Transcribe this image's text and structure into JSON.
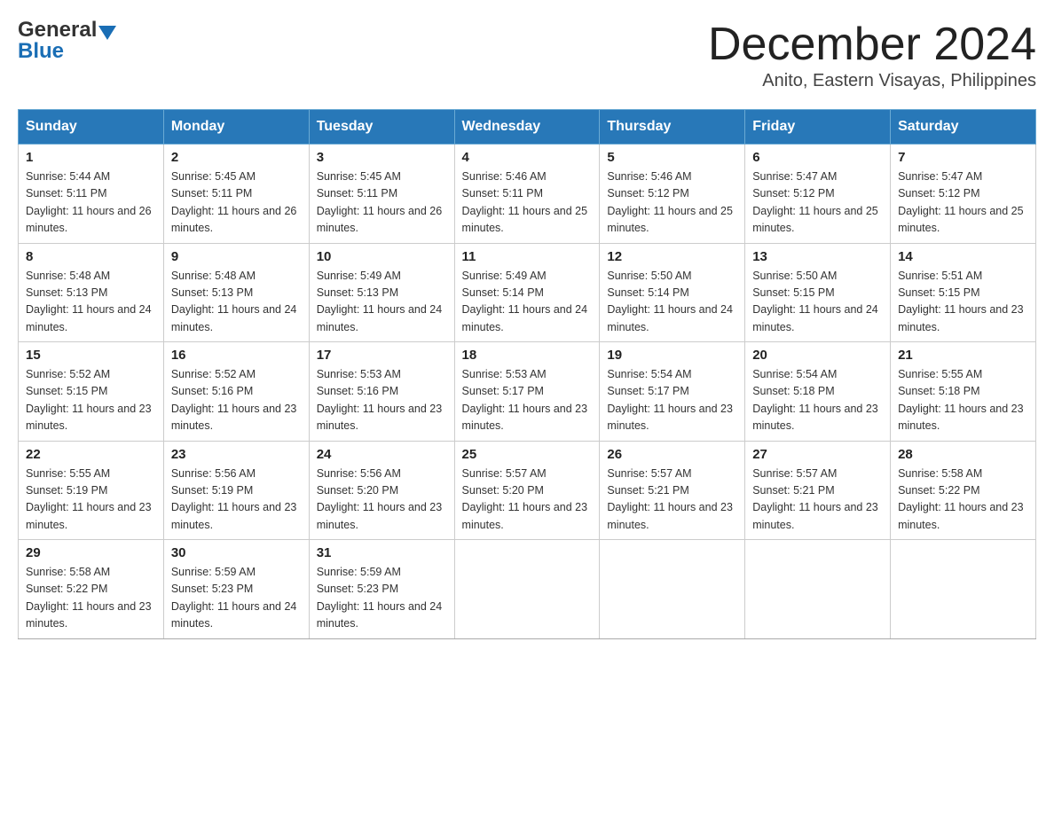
{
  "header": {
    "logo_general": "General",
    "logo_blue": "Blue",
    "title": "December 2024",
    "subtitle": "Anito, Eastern Visayas, Philippines"
  },
  "days_of_week": [
    "Sunday",
    "Monday",
    "Tuesday",
    "Wednesday",
    "Thursday",
    "Friday",
    "Saturday"
  ],
  "weeks": [
    [
      {
        "day": "1",
        "sunrise": "5:44 AM",
        "sunset": "5:11 PM",
        "daylight": "11 hours and 26 minutes."
      },
      {
        "day": "2",
        "sunrise": "5:45 AM",
        "sunset": "5:11 PM",
        "daylight": "11 hours and 26 minutes."
      },
      {
        "day": "3",
        "sunrise": "5:45 AM",
        "sunset": "5:11 PM",
        "daylight": "11 hours and 26 minutes."
      },
      {
        "day": "4",
        "sunrise": "5:46 AM",
        "sunset": "5:11 PM",
        "daylight": "11 hours and 25 minutes."
      },
      {
        "day": "5",
        "sunrise": "5:46 AM",
        "sunset": "5:12 PM",
        "daylight": "11 hours and 25 minutes."
      },
      {
        "day": "6",
        "sunrise": "5:47 AM",
        "sunset": "5:12 PM",
        "daylight": "11 hours and 25 minutes."
      },
      {
        "day": "7",
        "sunrise": "5:47 AM",
        "sunset": "5:12 PM",
        "daylight": "11 hours and 25 minutes."
      }
    ],
    [
      {
        "day": "8",
        "sunrise": "5:48 AM",
        "sunset": "5:13 PM",
        "daylight": "11 hours and 24 minutes."
      },
      {
        "day": "9",
        "sunrise": "5:48 AM",
        "sunset": "5:13 PM",
        "daylight": "11 hours and 24 minutes."
      },
      {
        "day": "10",
        "sunrise": "5:49 AM",
        "sunset": "5:13 PM",
        "daylight": "11 hours and 24 minutes."
      },
      {
        "day": "11",
        "sunrise": "5:49 AM",
        "sunset": "5:14 PM",
        "daylight": "11 hours and 24 minutes."
      },
      {
        "day": "12",
        "sunrise": "5:50 AM",
        "sunset": "5:14 PM",
        "daylight": "11 hours and 24 minutes."
      },
      {
        "day": "13",
        "sunrise": "5:50 AM",
        "sunset": "5:15 PM",
        "daylight": "11 hours and 24 minutes."
      },
      {
        "day": "14",
        "sunrise": "5:51 AM",
        "sunset": "5:15 PM",
        "daylight": "11 hours and 23 minutes."
      }
    ],
    [
      {
        "day": "15",
        "sunrise": "5:52 AM",
        "sunset": "5:15 PM",
        "daylight": "11 hours and 23 minutes."
      },
      {
        "day": "16",
        "sunrise": "5:52 AM",
        "sunset": "5:16 PM",
        "daylight": "11 hours and 23 minutes."
      },
      {
        "day": "17",
        "sunrise": "5:53 AM",
        "sunset": "5:16 PM",
        "daylight": "11 hours and 23 minutes."
      },
      {
        "day": "18",
        "sunrise": "5:53 AM",
        "sunset": "5:17 PM",
        "daylight": "11 hours and 23 minutes."
      },
      {
        "day": "19",
        "sunrise": "5:54 AM",
        "sunset": "5:17 PM",
        "daylight": "11 hours and 23 minutes."
      },
      {
        "day": "20",
        "sunrise": "5:54 AM",
        "sunset": "5:18 PM",
        "daylight": "11 hours and 23 minutes."
      },
      {
        "day": "21",
        "sunrise": "5:55 AM",
        "sunset": "5:18 PM",
        "daylight": "11 hours and 23 minutes."
      }
    ],
    [
      {
        "day": "22",
        "sunrise": "5:55 AM",
        "sunset": "5:19 PM",
        "daylight": "11 hours and 23 minutes."
      },
      {
        "day": "23",
        "sunrise": "5:56 AM",
        "sunset": "5:19 PM",
        "daylight": "11 hours and 23 minutes."
      },
      {
        "day": "24",
        "sunrise": "5:56 AM",
        "sunset": "5:20 PM",
        "daylight": "11 hours and 23 minutes."
      },
      {
        "day": "25",
        "sunrise": "5:57 AM",
        "sunset": "5:20 PM",
        "daylight": "11 hours and 23 minutes."
      },
      {
        "day": "26",
        "sunrise": "5:57 AM",
        "sunset": "5:21 PM",
        "daylight": "11 hours and 23 minutes."
      },
      {
        "day": "27",
        "sunrise": "5:57 AM",
        "sunset": "5:21 PM",
        "daylight": "11 hours and 23 minutes."
      },
      {
        "day": "28",
        "sunrise": "5:58 AM",
        "sunset": "5:22 PM",
        "daylight": "11 hours and 23 minutes."
      }
    ],
    [
      {
        "day": "29",
        "sunrise": "5:58 AM",
        "sunset": "5:22 PM",
        "daylight": "11 hours and 23 minutes."
      },
      {
        "day": "30",
        "sunrise": "5:59 AM",
        "sunset": "5:23 PM",
        "daylight": "11 hours and 24 minutes."
      },
      {
        "day": "31",
        "sunrise": "5:59 AM",
        "sunset": "5:23 PM",
        "daylight": "11 hours and 24 minutes."
      },
      null,
      null,
      null,
      null
    ]
  ],
  "labels": {
    "sunrise_prefix": "Sunrise: ",
    "sunset_prefix": "Sunset: ",
    "daylight_prefix": "Daylight: "
  }
}
